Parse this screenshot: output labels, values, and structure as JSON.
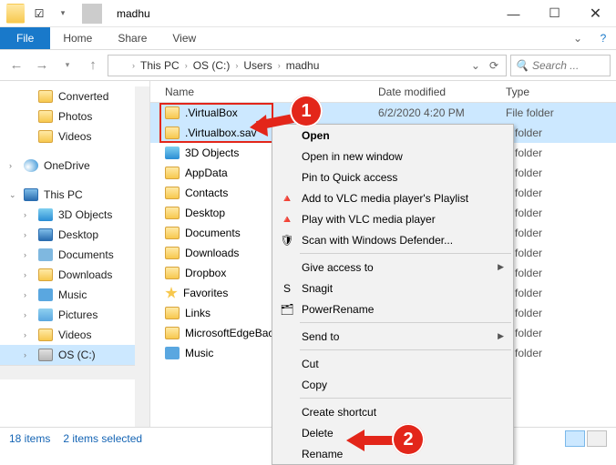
{
  "title": "madhu",
  "qat": {
    "chk": "☑"
  },
  "ribbon": {
    "file": "File",
    "home": "Home",
    "share": "Share",
    "view": "View"
  },
  "nav": {
    "back": "←",
    "fwd": "→",
    "up": "↑",
    "refresh": "⟳"
  },
  "breadcrumb": [
    "This PC",
    "OS (C:)",
    "Users",
    "madhu"
  ],
  "search_placeholder": "Search ...",
  "columns": {
    "name": "Name",
    "date": "Date modified",
    "type": "Type"
  },
  "sidebar": {
    "items": [
      {
        "label": "Converted",
        "icon": "ico-folder",
        "level": 1
      },
      {
        "label": "Photos",
        "icon": "ico-folder",
        "level": 1
      },
      {
        "label": "Videos",
        "icon": "ico-folder",
        "level": 1
      }
    ],
    "onedrive": "OneDrive",
    "thispc": "This PC",
    "pc_items": [
      {
        "label": "3D Objects",
        "icon": "row-3d"
      },
      {
        "label": "Desktop",
        "icon": "ico-pc"
      },
      {
        "label": "Documents",
        "icon": "ico-doc"
      },
      {
        "label": "Downloads",
        "icon": "ico-folder"
      },
      {
        "label": "Music",
        "icon": "ico-music"
      },
      {
        "label": "Pictures",
        "icon": "ico-pic"
      },
      {
        "label": "Videos",
        "icon": "ico-folder"
      },
      {
        "label": "OS (C:)",
        "icon": "ico-disk"
      }
    ]
  },
  "files": [
    {
      "name": ".VirtualBox",
      "date": "6/2/2020 4:20 PM",
      "type": "File folder",
      "selected": true
    },
    {
      "name": ".Virtualbox.sav",
      "date": "",
      "type": "e folder",
      "selected": true
    },
    {
      "name": "3D Objects",
      "date": "",
      "type": "e folder",
      "icon": "row-3d"
    },
    {
      "name": "AppData",
      "date": "",
      "type": "e folder"
    },
    {
      "name": "Contacts",
      "date": "",
      "type": "e folder"
    },
    {
      "name": "Desktop",
      "date": "",
      "type": "e folder"
    },
    {
      "name": "Documents",
      "date": "",
      "type": "e folder"
    },
    {
      "name": "Downloads",
      "date": "",
      "type": "e folder"
    },
    {
      "name": "Dropbox",
      "date": "",
      "type": "e folder"
    },
    {
      "name": "Favorites",
      "date": "",
      "type": "e folder",
      "icon": "row-star"
    },
    {
      "name": "Links",
      "date": "",
      "type": "e folder"
    },
    {
      "name": "MicrosoftEdgeBacku",
      "date": "",
      "type": "e folder"
    },
    {
      "name": "Music",
      "date": "",
      "type": "e folder",
      "icon": "ico-music"
    }
  ],
  "context_menu": [
    {
      "label": "Open",
      "bold": true
    },
    {
      "label": "Open in new window"
    },
    {
      "label": "Pin to Quick access"
    },
    {
      "label": "Add to VLC media player's Playlist",
      "icon": "🔺"
    },
    {
      "label": "Play with VLC media player",
      "icon": "🔺"
    },
    {
      "label": "Scan with Windows Defender...",
      "icon": "🛡"
    },
    {
      "sep": true
    },
    {
      "label": "Give access to",
      "sub": true
    },
    {
      "label": "Snagit",
      "icon": "S"
    },
    {
      "label": "PowerRename",
      "icon": "🗂"
    },
    {
      "sep": true
    },
    {
      "label": "Send to",
      "sub": true
    },
    {
      "sep": true
    },
    {
      "label": "Cut"
    },
    {
      "label": "Copy"
    },
    {
      "sep": true
    },
    {
      "label": "Create shortcut"
    },
    {
      "label": "Delete",
      "highlight": false
    },
    {
      "label": "Rename"
    }
  ],
  "status": {
    "items": "18 items",
    "selected": "2 items selected"
  },
  "badges": {
    "1": "1",
    "2": "2"
  }
}
